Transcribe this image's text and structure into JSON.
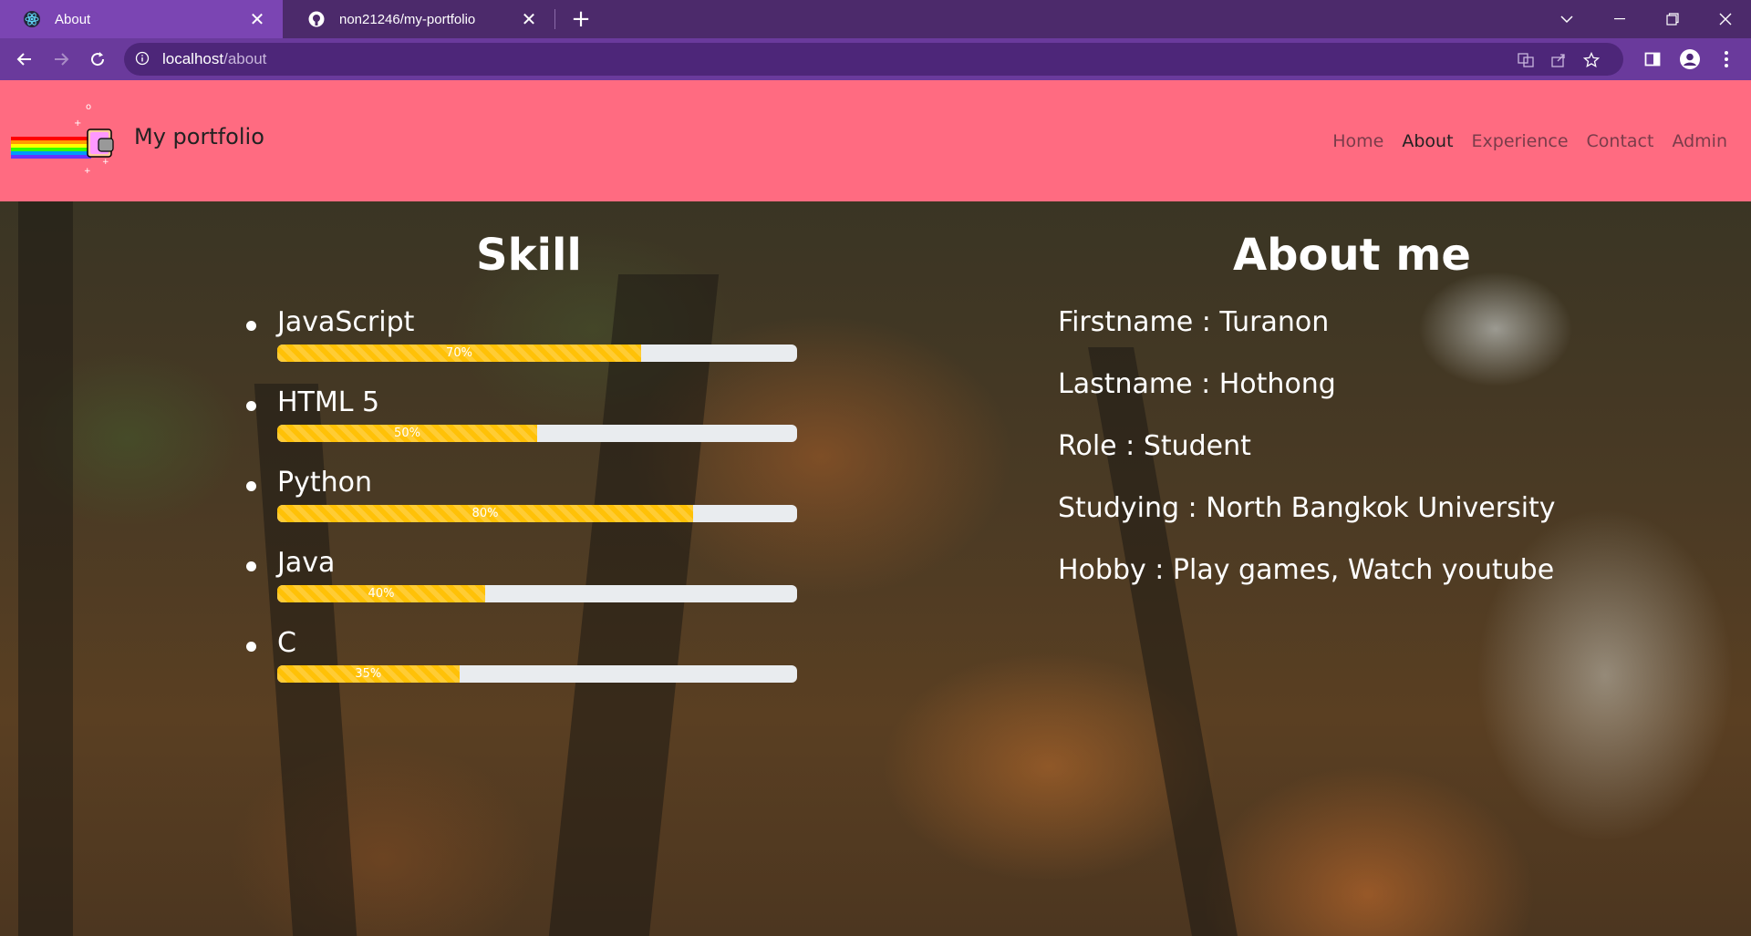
{
  "browser": {
    "tabs": [
      {
        "title": "About",
        "icon": "react-icon",
        "active": true
      },
      {
        "title": "non21246/my-portfolio",
        "icon": "github-icon",
        "active": false
      }
    ],
    "url_host": "localhost",
    "url_path": "/about"
  },
  "header": {
    "brand": "My portfolio",
    "nav": [
      "Home",
      "About",
      "Experience",
      "Contact",
      "Admin"
    ],
    "active_nav": "About"
  },
  "skills": {
    "title": "Skill",
    "items": [
      {
        "name": "JavaScript",
        "percent": 70,
        "label": "70%"
      },
      {
        "name": "HTML 5",
        "percent": 50,
        "label": "50%"
      },
      {
        "name": "Python",
        "percent": 80,
        "label": "80%"
      },
      {
        "name": "Java",
        "percent": 40,
        "label": "40%"
      },
      {
        "name": "C",
        "percent": 35,
        "label": "35%"
      }
    ]
  },
  "about": {
    "title": "About me",
    "lines": [
      "Firstname : Turanon",
      "Lastname : Hothong",
      "Role : Student",
      "Studying : North Bangkok University",
      "Hobby : Play games, Watch youtube"
    ]
  },
  "colors": {
    "header_bg": "#ff6b81",
    "progress_fill": "#ffc107",
    "progress_track": "#e9ecef",
    "chrome_tab_active": "#7b45b3"
  }
}
